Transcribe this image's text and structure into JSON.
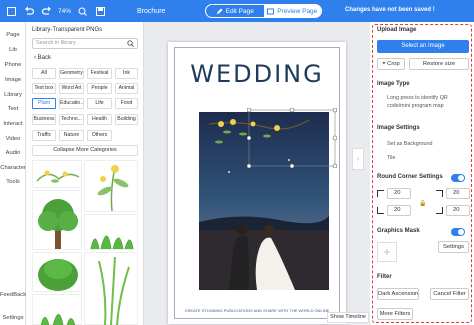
{
  "topbar": {
    "zoom": "74%",
    "title": "Brochure",
    "edit_page": "Edit Page",
    "preview_page": "Preview Page",
    "saved_status": "Changes have not been saved !"
  },
  "rail": {
    "items": [
      "Page",
      "Lib",
      "Phone",
      "Image",
      "Library",
      "Text",
      "Interact",
      "Video",
      "Audio",
      "Character",
      "Tools",
      "FeedBack",
      "Settings"
    ]
  },
  "library": {
    "title": "Library-Transparent PNGs",
    "search_placeholder": "Search in library",
    "back": "Back",
    "categories": [
      "All",
      "Geometry",
      "Festival",
      "Ink",
      "Text box",
      "Word Art",
      "People",
      "Animal",
      "Plant",
      "Educatio...",
      "Life",
      "Food",
      "Business",
      "Techno...",
      "Health",
      "Building",
      "Traffic",
      "Nature",
      "Others"
    ],
    "selected_category": "Plant",
    "collapse_label": "Collapse More Categories"
  },
  "canvas": {
    "heading": "WEDDING",
    "caption": "CREATE STUNNING PUBLICATIONS AND SHARE WITH THE WORLD ONLINE",
    "show_timeline": "Show Timeline"
  },
  "right_panel": {
    "upload_image": "Upload Image",
    "add_image": "Select an Image",
    "crop": "Crop",
    "restore_size": "Restore size",
    "image_type": "Image Type",
    "image_type_text": "Long press to identify QR code/mini program map",
    "image_settings": "Image Settings",
    "as_background": "Set as Background",
    "tile": "Tile",
    "round_corner": "Round Corner Settings",
    "corner_values": [
      "20",
      "20",
      "20",
      "20"
    ],
    "graphics_mask": "Graphics Mask",
    "mask_settings": "Settings",
    "filter": "Filter",
    "dark_ascension": "Dark Ascension",
    "cancel_filter": "Cancel Filter",
    "more_filters": "More Filters"
  },
  "colors": {
    "accent": "#2f80ed",
    "highlight_border": "#e23b3b",
    "heading": "#1e3a5c"
  }
}
